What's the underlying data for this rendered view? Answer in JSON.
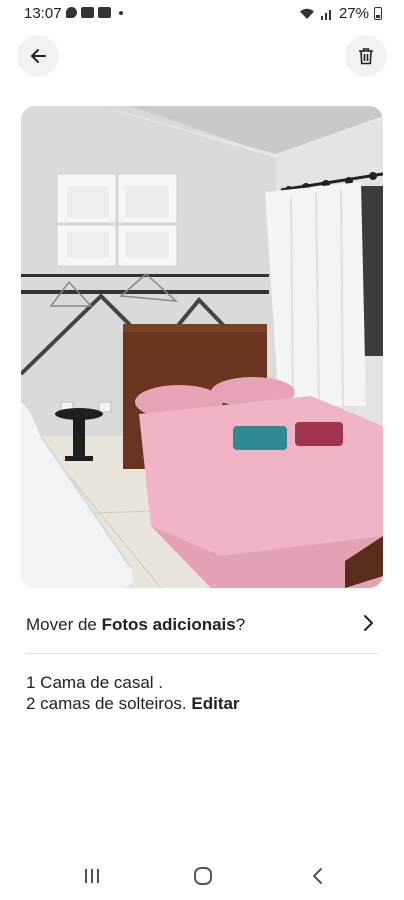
{
  "status_bar": {
    "time": "13:07",
    "battery": "27%"
  },
  "header": {
    "back_icon": "arrow-left-icon",
    "delete_icon": "trash-icon"
  },
  "photo": {
    "subject": "bedroom-photo"
  },
  "move_row": {
    "prefix": "Mover de ",
    "album": "Fotos adicionais",
    "suffix": "?",
    "icon": "chevron-right-icon"
  },
  "caption": {
    "line1": "1 Cama de casal .",
    "line2": "2 camas de solteiros.",
    "edit_label": "Editar"
  },
  "nav": {
    "recent_icon": "recent-apps-icon",
    "home_icon": "home-icon",
    "back_icon": "nav-back-icon"
  }
}
